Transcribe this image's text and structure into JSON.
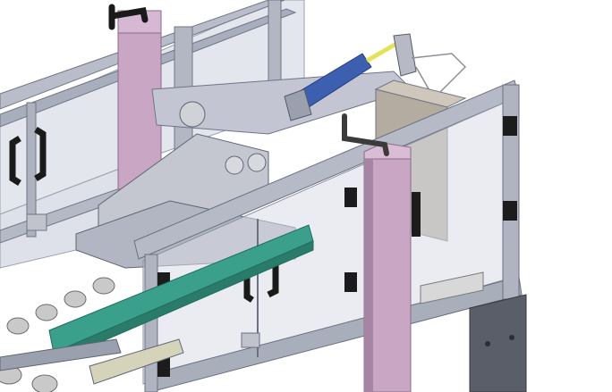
{
  "scene": {
    "description_none": "",
    "colors": {
      "background": "#ffffff",
      "extrusion": "#b9bdca",
      "extrusion_dark": "#7e8494",
      "panel_glass": "#e2e4ec",
      "pillar": "#c8a6c4",
      "pillar_dark": "#a684a3",
      "cylinder": "#3d5fb0",
      "cylinder_rod": "#e3e35a",
      "belt": "#3aa08c",
      "roller": "#c9c9c9",
      "handle": "#1a1a1a",
      "plate": "#5a5e69"
    },
    "icons": {
      "handles": "door-handle-icon",
      "crank": "crank-handle-icon"
    }
  }
}
